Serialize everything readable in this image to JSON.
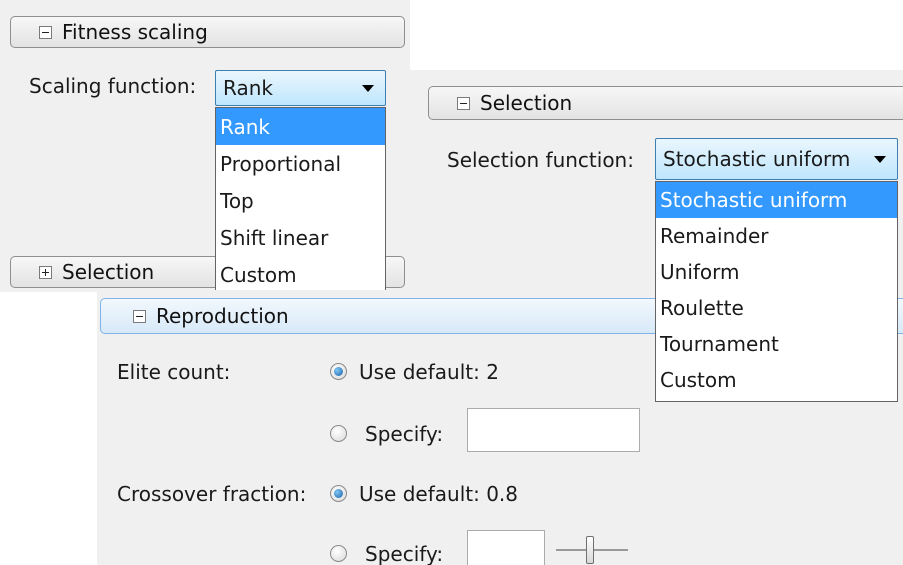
{
  "fitness_panel": {
    "header": "Fitness scaling",
    "scaling_label": "Scaling function:",
    "selected": "Rank",
    "options": [
      "Rank",
      "Proportional",
      "Top",
      "Shift linear",
      "Custom"
    ],
    "collapsed_section": "Selection"
  },
  "selection_panel": {
    "header": "Selection",
    "function_label": "Selection function:",
    "selected": "Stochastic uniform",
    "options": [
      "Stochastic uniform",
      "Remainder",
      "Uniform",
      "Roulette",
      "Tournament",
      "Custom"
    ]
  },
  "reproduction_panel": {
    "header": "Reproduction",
    "elite_label": "Elite count:",
    "elite_default": "Use default: 2",
    "elite_specify": "Specify:",
    "elite_value": "",
    "crossover_label": "Crossover fraction:",
    "crossover_default": "Use default: 0.8",
    "crossover_specify": "Specify:",
    "crossover_value": ""
  },
  "colors": {
    "highlight": "#3399ff",
    "panel_bg": "#f0f0f0",
    "header_blue": "#d7e9f8"
  }
}
